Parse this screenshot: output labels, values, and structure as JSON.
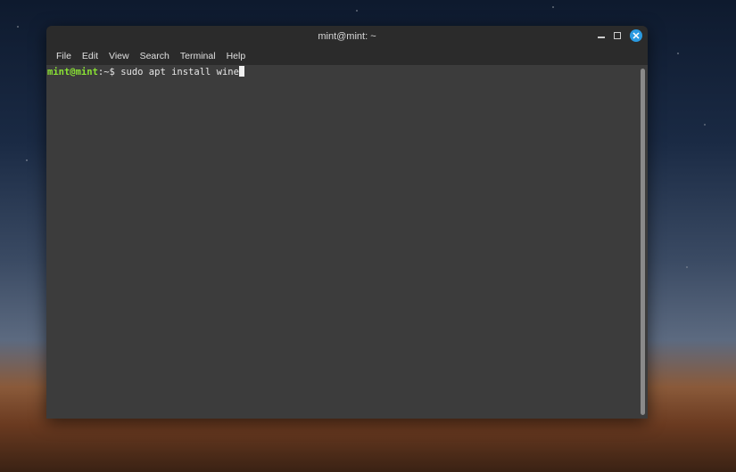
{
  "window": {
    "title": "mint@mint: ~"
  },
  "menu": [
    "File",
    "Edit",
    "View",
    "Search",
    "Terminal",
    "Help"
  ],
  "terminal": {
    "prompt_user": "mint@mint",
    "prompt_path": ":~$ ",
    "command": "sudo apt install wine"
  },
  "colors": {
    "accent": "#2a9ae0",
    "prompt": "#8ae234"
  }
}
